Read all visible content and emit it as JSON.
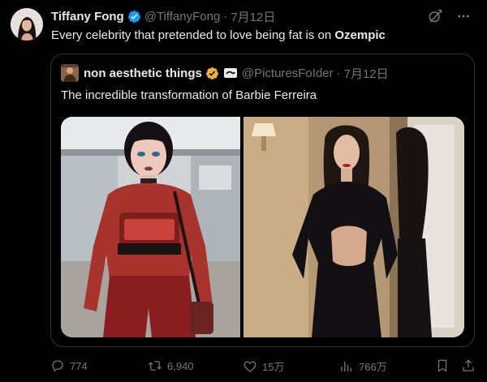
{
  "author": {
    "name": "Tiffany Fong",
    "handle": "@TiffanyFong",
    "separator": "·",
    "date": "7月12日",
    "verified_color": "#1d9bf0",
    "avatar_icon": "user-avatar"
  },
  "tweet": {
    "text_prefix": "Every celebrity that pretended to love being fat is on ",
    "text_bold": "Ozempic"
  },
  "quoted": {
    "name": "non aesthetic things",
    "handle": "@PicturesFoIder",
    "separator": "·",
    "date": "7月12日",
    "verified_color": "#e8b33a",
    "text": "The incredible transformation of Barbie Ferreira",
    "images": [
      "photo-before",
      "photo-after"
    ]
  },
  "stats": {
    "replies": "774",
    "reposts": "6,940",
    "likes": "15万",
    "views": "766万"
  },
  "colors": {
    "background": "#000000",
    "text": "#e7e9ea",
    "muted": "#71767b",
    "border": "#2f3336"
  },
  "icons": {
    "grok": "grok-icon",
    "more": "more-icon",
    "reply": "reply-icon",
    "repost": "repost-icon",
    "like": "heart-icon",
    "views": "views-icon",
    "bookmark": "bookmark-icon",
    "share": "share-icon"
  }
}
